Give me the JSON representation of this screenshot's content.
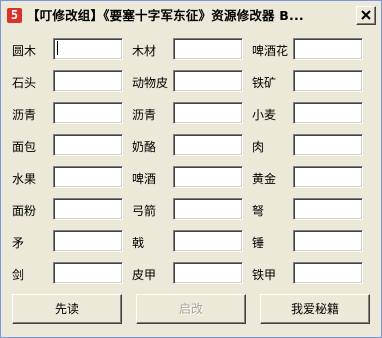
{
  "window": {
    "title": "【叮修改组】《要塞十字军东征》资源修改器 B...",
    "icon_glyph": "5"
  },
  "fields": [
    {
      "label": "圆木",
      "value": ""
    },
    {
      "label": "木材",
      "value": ""
    },
    {
      "label": "啤酒花",
      "value": ""
    },
    {
      "label": "石头",
      "value": ""
    },
    {
      "label": "动物皮",
      "value": ""
    },
    {
      "label": "铁矿",
      "value": ""
    },
    {
      "label": "沥青",
      "value": ""
    },
    {
      "label": "沥青",
      "value": ""
    },
    {
      "label": "小麦",
      "value": ""
    },
    {
      "label": "面包",
      "value": ""
    },
    {
      "label": "奶酪",
      "value": ""
    },
    {
      "label": "肉",
      "value": ""
    },
    {
      "label": "水果",
      "value": ""
    },
    {
      "label": "啤酒",
      "value": ""
    },
    {
      "label": "黄金",
      "value": ""
    },
    {
      "label": "面粉",
      "value": ""
    },
    {
      "label": "弓箭",
      "value": ""
    },
    {
      "label": "弩",
      "value": ""
    },
    {
      "label": "矛",
      "value": ""
    },
    {
      "label": "戟",
      "value": ""
    },
    {
      "label": "锤",
      "value": ""
    },
    {
      "label": "剑",
      "value": ""
    },
    {
      "label": "皮甲",
      "value": ""
    },
    {
      "label": "铁甲",
      "value": ""
    }
  ],
  "buttons": {
    "read": "先读",
    "activate": "启改",
    "secret": "我爱秘籍"
  },
  "colors": {
    "face": "#ece9d8",
    "icon": "#d9332b",
    "disabled_text": "#a8a798"
  }
}
